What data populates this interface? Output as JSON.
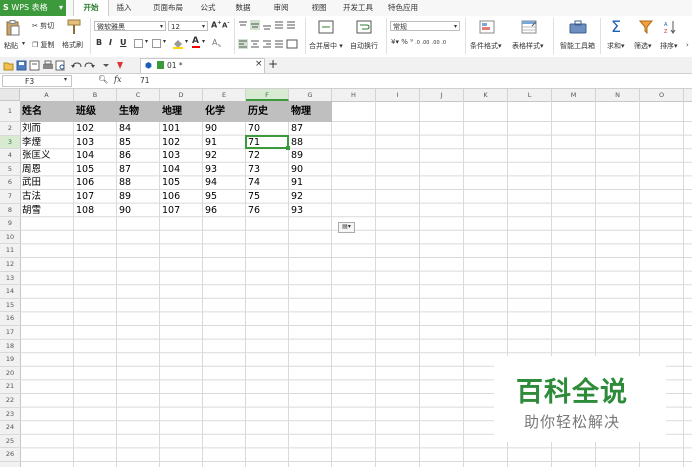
{
  "app": {
    "name": "WPS 表格",
    "menu_arrow": "▾"
  },
  "tabs": [
    "开始",
    "插入",
    "页面布局",
    "公式",
    "数据",
    "审阅",
    "视图",
    "开发工具",
    "特色应用"
  ],
  "ribbon": {
    "paste": "粘贴",
    "cut": "剪切",
    "copy": "复制",
    "format_painter": "格式刷",
    "font_name": "微软雅黑",
    "font_size": "12",
    "merge_center": "合并居中",
    "auto_wrap": "自动换行",
    "number_format": "常规",
    "conditional_format": "条件格式",
    "table_style": "表格样式",
    "smart_toolbox": "智能工具箱",
    "sum": "求和",
    "filter": "筛选",
    "sort": "排序"
  },
  "doc_tab": {
    "name": "01 *",
    "close": "×",
    "add": "+"
  },
  "formula_bar": {
    "cell_ref": "F3",
    "fx": "fx",
    "content": "71"
  },
  "columns": [
    "A",
    "B",
    "C",
    "D",
    "E",
    "F",
    "G",
    "H",
    "I",
    "J",
    "K",
    "L",
    "M",
    "N",
    "O"
  ],
  "selected_column": "F",
  "selected_row": "3",
  "rows": [
    "1",
    "2",
    "3",
    "4",
    "5",
    "6",
    "7",
    "8",
    "9",
    "10",
    "11",
    "12",
    "13",
    "14",
    "15",
    "16",
    "17",
    "18",
    "19",
    "20",
    "21",
    "22",
    "23",
    "24",
    "25",
    "26"
  ],
  "table": {
    "headers": [
      "姓名",
      "班级",
      "生物",
      "地理",
      "化学",
      "历史",
      "物理"
    ],
    "data": [
      [
        "刘而",
        "102",
        "84",
        "101",
        "90",
        "70",
        "87"
      ],
      [
        "李煙",
        "103",
        "85",
        "102",
        "91",
        "71",
        "88"
      ],
      [
        "张匡义",
        "104",
        "86",
        "103",
        "92",
        "72",
        "89"
      ],
      [
        "周恩",
        "105",
        "87",
        "104",
        "93",
        "73",
        "90"
      ],
      [
        "武田",
        "106",
        "88",
        "105",
        "94",
        "74",
        "91"
      ],
      [
        "古法",
        "107",
        "89",
        "106",
        "95",
        "75",
        "92"
      ],
      [
        "胡雪",
        "108",
        "90",
        "107",
        "96",
        "76",
        "93"
      ]
    ]
  },
  "watermark": {
    "title": "百科全说",
    "subtitle": "助你轻松解决"
  },
  "colors": {
    "accent": "#3c9a3c",
    "header_fill": "#bfbfbf",
    "selection": "#3c9a3c",
    "watermark_green": "#2d8b3a"
  }
}
